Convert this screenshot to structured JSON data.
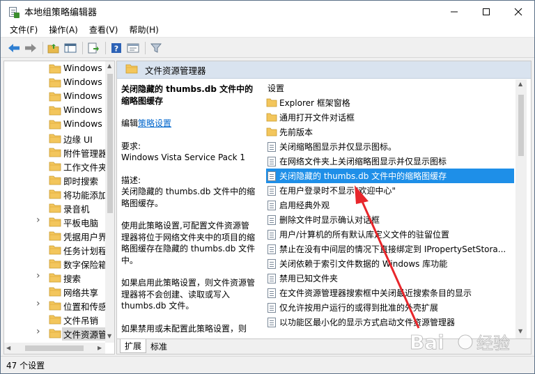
{
  "window": {
    "title": "本地组策略编辑器"
  },
  "menu": {
    "file": "文件(F)",
    "action": "操作(A)",
    "view": "查看(V)",
    "help": "帮助(H)"
  },
  "tree": {
    "items": [
      {
        "label": "Windows",
        "expandable": false
      },
      {
        "label": "Windows",
        "expandable": false
      },
      {
        "label": "Windows",
        "expandable": false
      },
      {
        "label": "Windows",
        "expandable": false
      },
      {
        "label": "Windows",
        "expandable": false
      },
      {
        "label": "边缘 UI",
        "expandable": false
      },
      {
        "label": "附件管理器",
        "expandable": false
      },
      {
        "label": "工作文件夹",
        "expandable": false
      },
      {
        "label": "即时搜索",
        "expandable": false
      },
      {
        "label": "将功能添加",
        "expandable": false
      },
      {
        "label": "录音机",
        "expandable": false
      },
      {
        "label": "平板电脑",
        "expandable": true
      },
      {
        "label": "凭据用户界",
        "expandable": false
      },
      {
        "label": "任务计划程",
        "expandable": false
      },
      {
        "label": "数字保险箱",
        "expandable": false
      },
      {
        "label": "搜索",
        "expandable": true
      },
      {
        "label": "网络共享",
        "expandable": false
      },
      {
        "label": "位置和传感",
        "expandable": true
      },
      {
        "label": "文件吊销",
        "expandable": false
      },
      {
        "label": "文件资源管",
        "expandable": true,
        "selected": true
      }
    ]
  },
  "header": {
    "title": "文件资源管理器"
  },
  "description": {
    "title": "关闭隐藏的 thumbs.db 文件中的缩略图缓存",
    "edit_prefix": "编辑",
    "edit_link": "策略设置",
    "requirement_label": "要求:",
    "requirement_value": "Windows Vista Service Pack 1",
    "desc_label": "描述:",
    "desc_value": "关闭隐藏的 thumbs.db 文件中的缩略图缓存。",
    "para1": "使用此策略设置,可配置文件资源管理器将位于网络文件夹中的项目的缩略图缓存在隐藏的 thumbs.db 文件中。",
    "para2": "如果启用此策略设置，则文件资源管理器将不会创建、读取或写入 thumbs.db 文件。",
    "para3": "如果禁用或未配置此策略设置，则"
  },
  "list": {
    "header": "设置",
    "items": [
      {
        "label": "Explorer 框架窗格",
        "type": "folder"
      },
      {
        "label": "通用打开文件对话框",
        "type": "folder"
      },
      {
        "label": "先前版本",
        "type": "folder"
      },
      {
        "label": "关闭缩略图显示并仅显示图标。",
        "type": "policy"
      },
      {
        "label": "在网络文件夹上关闭缩略图显示并仅显示图标",
        "type": "policy"
      },
      {
        "label": "关闭隐藏的 thumbs.db 文件中的缩略图缓存",
        "type": "policy",
        "selected": true
      },
      {
        "label": "在用户登录时不显示\"欢迎中心\"",
        "type": "policy"
      },
      {
        "label": "启用经典外观",
        "type": "policy"
      },
      {
        "label": "删除文件时显示确认对话框",
        "type": "policy"
      },
      {
        "label": "用户/计算机的所有默认库定义文件的驻留位置",
        "type": "policy"
      },
      {
        "label": "禁止在没有中间层的情况下直接绑定到 IPropertySetStora...",
        "type": "policy"
      },
      {
        "label": "关闭依赖于索引文件数据的 Windows 库功能",
        "type": "policy"
      },
      {
        "label": "禁用已知文件夹",
        "type": "policy"
      },
      {
        "label": "在文件资源管理器搜索框中关闭最近搜索条目的显示",
        "type": "policy"
      },
      {
        "label": "仅允许按用户运行的或得到批准的外壳扩展",
        "type": "policy"
      },
      {
        "label": "以功能区最小化的显示方式启动文件资源管理器",
        "type": "policy"
      }
    ]
  },
  "tabs": {
    "extended": "扩展",
    "standard": "标准"
  },
  "status": {
    "text": "47 个设置"
  },
  "watermark": {
    "text": "Bai",
    "text2": "经验",
    "url": "jingyan.baidu.com"
  },
  "colors": {
    "selection": "#1e8fe8",
    "header_bg": "#d9e3ef",
    "arrow": "#e8262b",
    "link": "#0066cc"
  }
}
